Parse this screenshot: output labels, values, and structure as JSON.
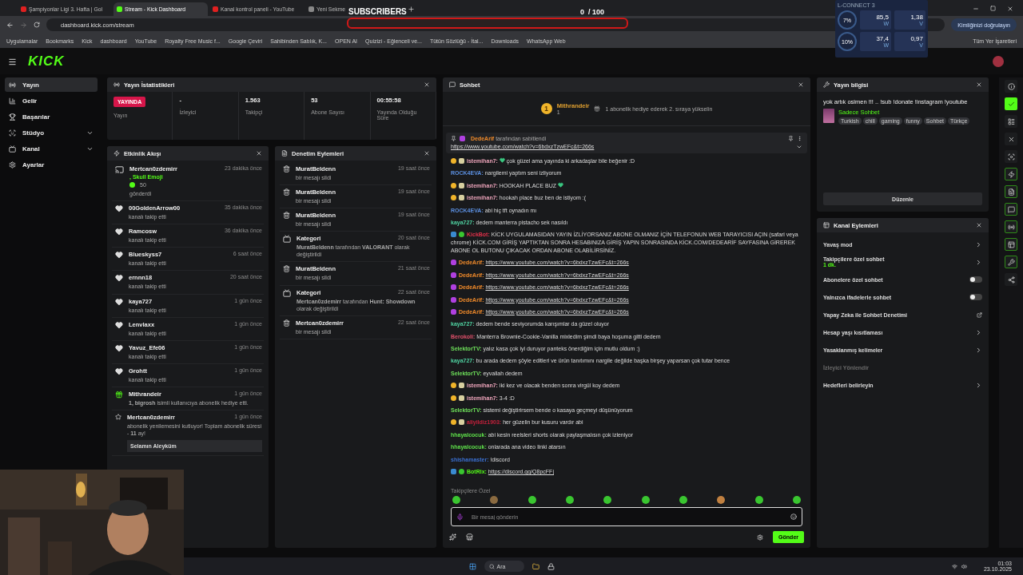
{
  "browser": {
    "tabs": [
      {
        "title": "Şampiyonlar Ligi 3. Hafta | Gol",
        "selected": false
      },
      {
        "title": "Stream - Kick Dashboard",
        "selected": true
      },
      {
        "title": "Kanal kontrol paneli - YouTube",
        "selected": false
      },
      {
        "title": "Yeni Sekme",
        "selected": false
      }
    ],
    "url": "dashboard.kick.com/stream",
    "verify_button": "Kimliğinizi doğrulayın",
    "bookmarks": [
      "Uygulamalar",
      "Bookmarks",
      "Kick",
      "dashboard",
      "YouTube",
      "Royalty Free Music f...",
      "Google Çeviri",
      "Sahibinden Satılık, K...",
      "OPEN AI",
      "Quizizi - Eğlenceli ve...",
      "Tütün Sözlüğü - İtal...",
      "Downloads",
      "WhatsApp Web"
    ],
    "all_bookmarks": "Tüm Yer İşaretleri"
  },
  "overlay": {
    "title": "SUBSCRIBERS",
    "count": "0",
    "goal": "/ 100",
    "level": 0
  },
  "monitor": {
    "title": "L-CONNECT 3",
    "rows": [
      {
        "percent": "7%",
        "power": "85,5",
        "power_unit": "W",
        "voltage": "1,38",
        "voltage_unit": "V"
      },
      {
        "percent": "10%",
        "power": "37,4",
        "power_unit": "W",
        "voltage": "0,97",
        "voltage_unit": "V"
      }
    ]
  },
  "header": {
    "logo": "KICK"
  },
  "sidebar": {
    "items": [
      {
        "label": "Yayın",
        "kind": "stream",
        "selected": true,
        "expandable": false
      },
      {
        "label": "Gelir",
        "kind": "income",
        "selected": false,
        "expandable": false
      },
      {
        "label": "Başarılar",
        "kind": "trophy",
        "selected": false,
        "expandable": false
      },
      {
        "label": "Stüdyo",
        "kind": "studio",
        "selected": false,
        "expandable": true
      },
      {
        "label": "Kanal",
        "kind": "channel",
        "selected": false,
        "expandable": true
      },
      {
        "label": "Ayarlar",
        "kind": "settings",
        "selected": false,
        "expandable": false
      }
    ]
  },
  "stats": {
    "title": "Yayın İstatistikleri",
    "items": [
      {
        "kind": "live",
        "badge": "YAYINDA",
        "label": "Yayın"
      },
      {
        "kind": "value",
        "value": "-",
        "label": "İzleyici"
      },
      {
        "kind": "value",
        "value": "1.563",
        "label": "Takipçi"
      },
      {
        "kind": "value",
        "value": "53",
        "label": "Abone Sayısı"
      },
      {
        "kind": "value",
        "value": "00:55:58",
        "label": "Yayında Olduğu Süre"
      }
    ]
  },
  "activity": {
    "title": "Etkinlik Akışı",
    "items": [
      {
        "kind": "kick",
        "name": "Mertcan0zdemirr",
        "time": "23 dakika önce",
        "note": ", Skull Emoji",
        "amount": "50",
        "text": "gönderdi"
      },
      {
        "kind": "follow",
        "name": "00GoldenArrow00",
        "time": "35 dakika önce",
        "text": "kanalı takip etti"
      },
      {
        "kind": "follow",
        "name": "Ramcosw",
        "time": "36 dakika önce",
        "text": "kanalı takip etti"
      },
      {
        "kind": "follow",
        "name": "Blueskyss7",
        "time": "6 saat önce",
        "text": "kanalı takip etti"
      },
      {
        "kind": "follow",
        "name": "ernnn18",
        "time": "20 saat önce",
        "text": "kanalı takip etti"
      },
      {
        "kind": "follow",
        "name": "kaya727",
        "time": "1 gün önce",
        "text": "kanalı takip etti"
      },
      {
        "kind": "follow",
        "name": "Lenvlaxx",
        "time": "1 gün önce",
        "text": "kanalı takip etti"
      },
      {
        "kind": "follow",
        "name": "Yavuz_Efe06",
        "time": "1 gün önce",
        "text": "kanalı takip etti"
      },
      {
        "kind": "follow",
        "name": "Grohtt",
        "time": "1 gün önce",
        "text": "kanalı takip etti"
      },
      {
        "kind": "gift",
        "name": "Mithrandeir",
        "time": "1 gün önce",
        "text": "**1, bigrosh** isimli kullanıcıya abonelik hediye etti."
      },
      {
        "kind": "resub",
        "name": "Mertcan0zdemirr",
        "time": "1 gün önce",
        "text": "abonelik yenilemesini kutluyor! Toplam abonelik süresi - **11** ay!",
        "message": "Selamın Aleyküm"
      }
    ]
  },
  "moderation": {
    "title": "Denetim Eylemleri",
    "items": [
      {
        "kind": "delete",
        "name": "MuratBeldenn",
        "time": "19 saat önce",
        "text": "bir mesajı sildi"
      },
      {
        "kind": "delete",
        "name": "MuratBeldenn",
        "time": "19 saat önce",
        "text": "bir mesajı sildi"
      },
      {
        "kind": "delete",
        "name": "MuratBeldenn",
        "time": "19 saat önce",
        "text": "bir mesajı sildi"
      },
      {
        "kind": "category",
        "name": "Kategori",
        "time": "20 saat önce",
        "text": "**MuratBeldenn** tarafından **VALORANT** olarak değiştirildi"
      },
      {
        "kind": "delete",
        "name": "MuratBeldenn",
        "time": "21 saat önce",
        "text": "bir mesajı sildi"
      },
      {
        "kind": "category",
        "name": "Kategori",
        "time": "22 saat önce",
        "text": "**Mertcan0zdemirr** tarafından **Hunt: Showdown** olarak değiştirildi"
      },
      {
        "kind": "delete",
        "name": "Mertcan0zdemirr",
        "time": "22 saat önce",
        "text": "bir mesajı sildi"
      }
    ]
  },
  "chat": {
    "title": "Sohbet",
    "leader": {
      "rank": "1",
      "name": "Mithrandeir",
      "count": "1",
      "hint": "1 abonelik hediye ederek 2. sıraya yükselin"
    },
    "pinned": {
      "user": "DedeArif",
      "by": "tarafından sabitlendi",
      "link": "https://www.youtube.com/watch?v=6bdxzTzwEFc&t=266s"
    },
    "messages": [
      {
        "badges": [
          {
            "kind": "sub"
          },
          {
            "kind": "gifter"
          }
        ],
        "user": "istemihan7:",
        "color": "#eaa2b8",
        "pre_emote": true,
        "text": "çok güzel ama yayında ki arkadaşlar bile beğenir :D"
      },
      {
        "user": "ROCK4EVA:",
        "color": "#5b8fe0",
        "text": "nargilemi yaptım seni izliyorum"
      },
      {
        "badges": [
          {
            "kind": "sub"
          },
          {
            "kind": "gifter"
          }
        ],
        "user": "istemihan7:",
        "color": "#eaa2b8",
        "post_emote": true,
        "text": "HOOKAH PLACE BUZ"
      },
      {
        "badges": [
          {
            "kind": "sub"
          },
          {
            "kind": "gifter"
          }
        ],
        "user": "istemihan7:",
        "color": "#eaa2b8",
        "text": "hookah place buz ben de istiyom :("
      },
      {
        "user": "ROCK4EVA:",
        "color": "#5b8fe0",
        "text": "abi hiç tft oynadın mı"
      },
      {
        "user": "kaya727:",
        "color": "#4fd1a0",
        "text": "dedem manterra pistacho sek nasıldı"
      },
      {
        "badges": [
          {
            "kind": "bot"
          },
          {
            "kind": "verified"
          }
        ],
        "user": "KickBot:",
        "color": "#e0304a",
        "text": "KİCK UYGULAMASIDAN YAYIN İZLİYORSANIZ ABONE OLMANIZ İÇİN TELEFONUN WEB TARAYICISI AÇIN (safari veya chrome) KİCK.COM GİRİŞ YAPTIKTAN SONRA HESABINIZA GİRİŞ YAPIN SONRASINDA KİCK.COM/DEDEARİF SAYFASINA GİREREK ABONE OL BUTONU ÇIKACAK ORDAN ABONE OLABİLİRSİNİZ."
      },
      {
        "badges": [
          {
            "kind": "broadcaster"
          }
        ],
        "user": "DedeArif:",
        "color": "#f08a2a",
        "link": "https://www.youtube.com/watch?v=6bdxzTzwEFc&t=266s"
      },
      {
        "badges": [
          {
            "kind": "broadcaster"
          }
        ],
        "user": "DedeArif:",
        "color": "#f08a2a",
        "link": "https://www.youtube.com/watch?v=6bdxzTzwEFc&t=266s"
      },
      {
        "badges": [
          {
            "kind": "broadcaster"
          }
        ],
        "user": "DedeArif:",
        "color": "#f08a2a",
        "link": "https://www.youtube.com/watch?v=6bdxzTzwEFc&t=266s"
      },
      {
        "badges": [
          {
            "kind": "broadcaster"
          }
        ],
        "user": "DedeArif:",
        "color": "#f08a2a",
        "link": "https://www.youtube.com/watch?v=6bdxzTzwEFc&t=266s"
      },
      {
        "badges": [
          {
            "kind": "broadcaster"
          }
        ],
        "user": "DedeArif:",
        "color": "#f08a2a",
        "link": "https://www.youtube.com/watch?v=6bdxzTzwEFc&t=266s"
      },
      {
        "user": "kaya727:",
        "color": "#4fd1a0",
        "text": "dedem bende seviyorumda karışımlar da güzel oluyor"
      },
      {
        "user": "Berokoli:",
        "color": "#e0506a",
        "text": "Manterra Brownie-Cookie-Vanilla mixledim şimdi baya hoşuma gitti dedem"
      },
      {
        "user": "SelektorTV:",
        "color": "#6ee05a",
        "text": "yalız kasa çok iyi duruyor panteks önerdiğim için mutlu oldum :)"
      },
      {
        "user": "kaya727:",
        "color": "#4fd1a0",
        "text": "bu arada dedem şöyle editleri ve ürün tanıtımını nargile değilde başka birşey yaparsan çok tutar bence"
      },
      {
        "user": "SelektorTV:",
        "color": "#6ee05a",
        "text": "eyvallah dedem"
      },
      {
        "badges": [
          {
            "kind": "sub"
          },
          {
            "kind": "gifter"
          }
        ],
        "user": "istemihan7:",
        "color": "#eaa2b8",
        "text": "iki kez ve olacak benden sonra virgül koy dedem"
      },
      {
        "badges": [
          {
            "kind": "sub"
          },
          {
            "kind": "gifter"
          }
        ],
        "user": "istemihan7:",
        "color": "#eaa2b8",
        "text": "3-4 :D"
      },
      {
        "user": "SelektorTV:",
        "color": "#6ee05a",
        "text": "sistemi değiştirirsem bende o kasaya geçmeyi düşünüyorum"
      },
      {
        "badges": [
          {
            "kind": "sub"
          },
          {
            "kind": "gifter"
          }
        ],
        "user": "aliyildiz1903:",
        "color": "#c0203a",
        "text": "her güzelin bur kusuru vardır abi"
      },
      {
        "user": "hhayalcocuk:",
        "color": "#5ee04a",
        "text": "abi kesin reelsleri shorts olarak paylaşmalısın çok izleniyor"
      },
      {
        "user": "hhayalcocuk:",
        "color": "#5ee04a",
        "text": "onlarada ana video linki atarsın"
      },
      {
        "user": "shishamaster:",
        "color": "#3a6fd0",
        "text": "!discord"
      },
      {
        "badges": [
          {
            "kind": "bot"
          },
          {
            "kind": "verified"
          }
        ],
        "user": "BotRix:",
        "color": "#53fc18",
        "link": "https://discord.gg/Q8pcFFj"
      }
    ],
    "emote_section": "Takipçilere Özel",
    "input": {
      "placeholder": "Bir mesaj gönderin"
    },
    "send": "Gönder"
  },
  "stream_info": {
    "title": "Yayın bilgisi",
    "stream_title": "yok artık osimen !!! .. !sub !donate !instagram !youtube",
    "category": "Sadece Sohbet",
    "tags": [
      "Turkish",
      "chill",
      "gaming",
      "funny",
      "Sohbet",
      "Türkçe"
    ],
    "edit": "Düzenle"
  },
  "channel_actions": {
    "title": "Kanal Eylemleri",
    "items": [
      {
        "kind": "link",
        "label": "Yavaş mod"
      },
      {
        "kind": "link",
        "label": "Takipçilere özel sohbet",
        "sub": "1 dk."
      },
      {
        "kind": "toggle",
        "label": "Abonelere özel sohbet",
        "on": false
      },
      {
        "kind": "toggle",
        "label": "Yalnızca ifadelerle sohbet",
        "on": false
      },
      {
        "kind": "external",
        "label": "Yapay Zeka ile Sohbet Denetimi"
      },
      {
        "kind": "link",
        "label": "Hesap yaşı kısıtlaması"
      },
      {
        "kind": "link",
        "label": "Yasaklanmış kelimeler"
      },
      {
        "kind": "disabled",
        "label": "İzleyici Yönlendir"
      },
      {
        "kind": "link",
        "label": "Hedefleri belirleyin"
      }
    ]
  },
  "rail": [
    {
      "kind": "info",
      "active": false
    },
    {
      "kind": "check",
      "active": true
    },
    {
      "kind": "layout",
      "active": false
    },
    {
      "kind": "close",
      "active": false
    },
    {
      "kind": "focus",
      "active": false
    },
    {
      "kind": "bolt",
      "active": true
    },
    {
      "kind": "note",
      "active": true
    },
    {
      "kind": "chat",
      "active": true
    },
    {
      "kind": "stats",
      "active": true
    },
    {
      "kind": "channel",
      "active": true
    },
    {
      "kind": "wrench",
      "active": true
    },
    {
      "kind": "share",
      "active": false
    }
  ],
  "taskbar": {
    "search": "Ara",
    "time": "01:03",
    "date": "23.10.2025"
  }
}
